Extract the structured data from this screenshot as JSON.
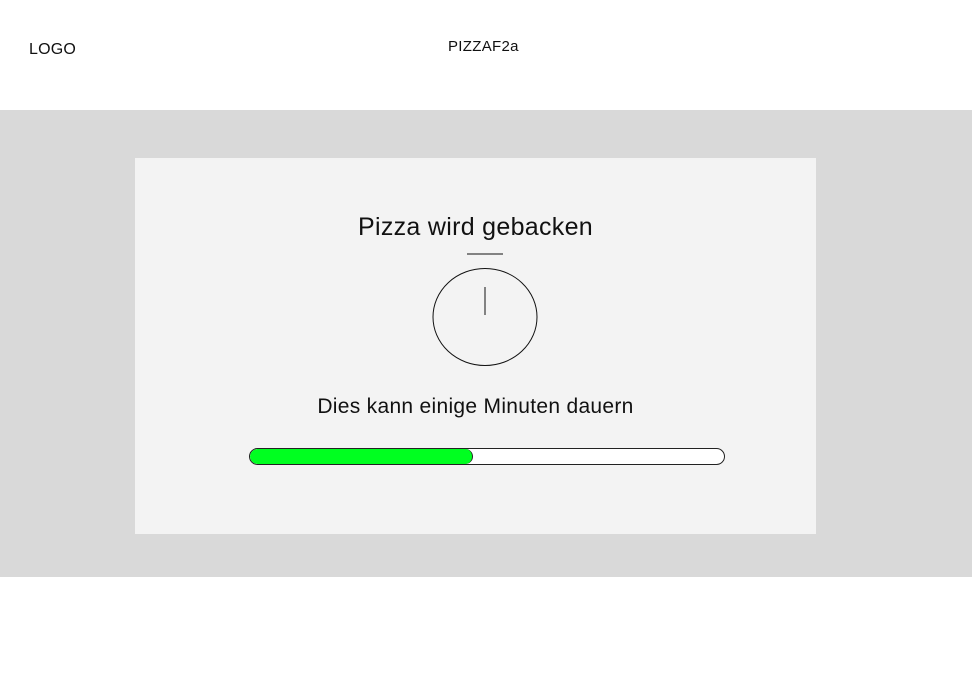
{
  "header": {
    "logo_text": "LOGO",
    "brand_text": "PIZZAF2a"
  },
  "status_card": {
    "title": "Pizza wird gebacken",
    "icon": "stopwatch-icon",
    "subtitle": "Dies kann einige Minuten dauern",
    "progress": {
      "value": 0.47,
      "fill_color": "#00ff20",
      "track_color": "#ffffff"
    }
  },
  "colors": {
    "band_background": "#d9d9d9",
    "card_background": "#f3f3f3",
    "page_background": "#ffffff"
  }
}
